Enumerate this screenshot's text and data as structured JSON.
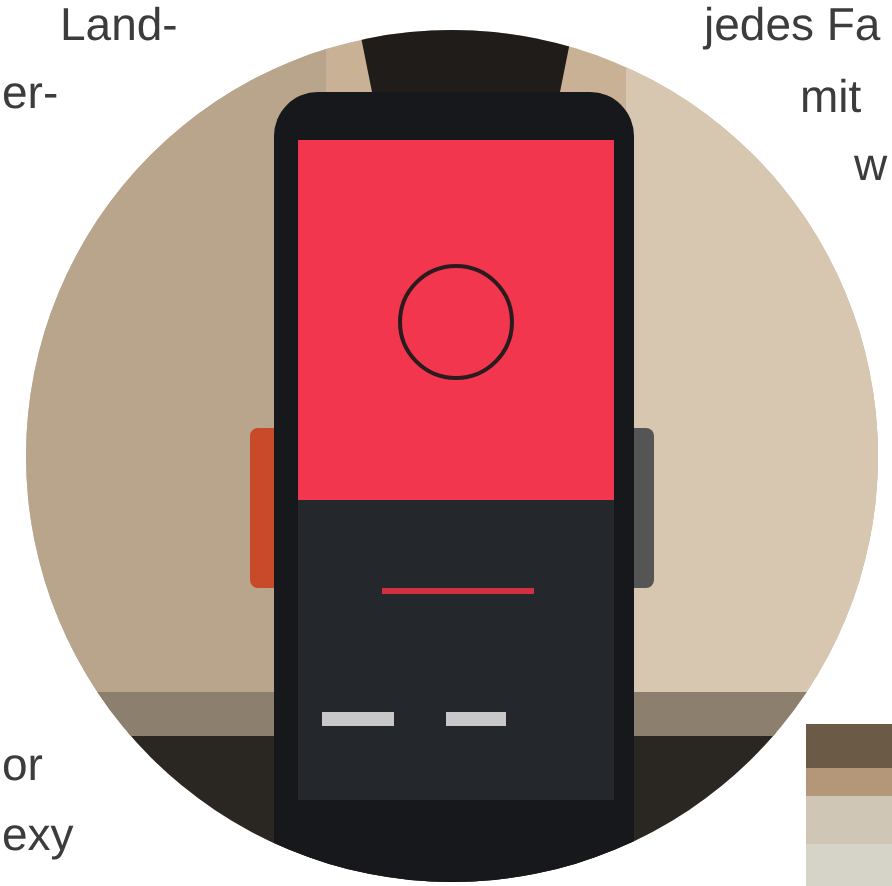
{
  "text_fragments": [
    {
      "text": "Land-"
    },
    {
      "text": "jedes Fa"
    },
    {
      "text": "er-"
    },
    {
      "text": "mit"
    },
    {
      "text": "w"
    },
    {
      "text": "or"
    },
    {
      "text": "exy"
    }
  ]
}
